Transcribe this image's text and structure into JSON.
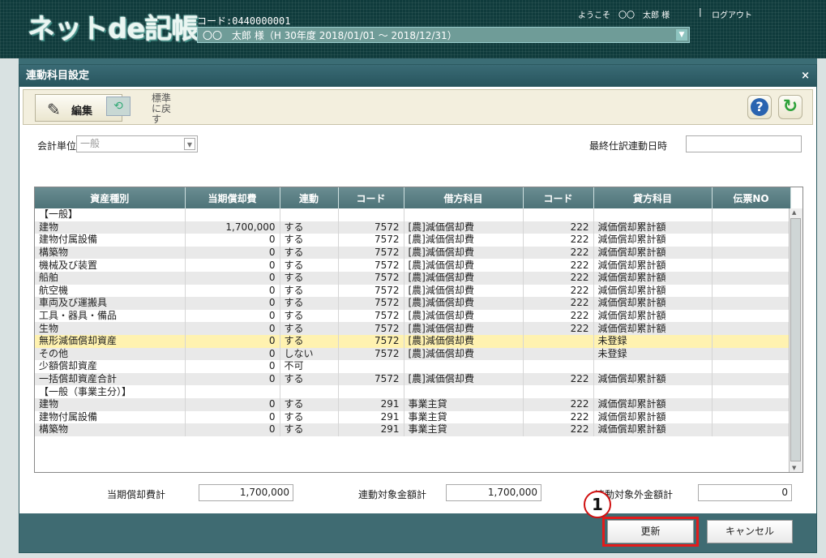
{
  "app": {
    "logo": "ネットde記帳",
    "code": "コード:0440000001",
    "user_info": "〇〇　太郎 様（H 30年度 2018/01/01 ～ 2018/12/31）",
    "welcome": "ようこそ　〇〇　太郎 様",
    "separator": "|",
    "logout": "ログアウト"
  },
  "dialog": {
    "title": "連動科目設定",
    "close": "×",
    "toolbar": {
      "edit_label": "編集",
      "reset_label": "標準に戻す"
    },
    "unit_label": "会計単位",
    "unit_value": "一般",
    "last_date_label": "最終仕訳連動日時",
    "last_date_value": ""
  },
  "grid": {
    "columns": [
      "資産種別",
      "当期償却費",
      "連動",
      "コード",
      "借方科目",
      "コード",
      "貸方科目",
      "伝票NO"
    ],
    "rows": [
      [
        "【一般】",
        "",
        "",
        "",
        "",
        "",
        "",
        ""
      ],
      [
        "建物",
        "1,700,000",
        "する",
        "7572",
        "[農]減価償却費",
        "222",
        "減価償却累計額",
        ""
      ],
      [
        "建物付属設備",
        "0",
        "する",
        "7572",
        "[農]減価償却費",
        "222",
        "減価償却累計額",
        ""
      ],
      [
        "構築物",
        "0",
        "する",
        "7572",
        "[農]減価償却費",
        "222",
        "減価償却累計額",
        ""
      ],
      [
        "機械及び装置",
        "0",
        "する",
        "7572",
        "[農]減価償却費",
        "222",
        "減価償却累計額",
        ""
      ],
      [
        "船舶",
        "0",
        "する",
        "7572",
        "[農]減価償却費",
        "222",
        "減価償却累計額",
        ""
      ],
      [
        "航空機",
        "0",
        "する",
        "7572",
        "[農]減価償却費",
        "222",
        "減価償却累計額",
        ""
      ],
      [
        "車両及び運搬具",
        "0",
        "する",
        "7572",
        "[農]減価償却費",
        "222",
        "減価償却累計額",
        ""
      ],
      [
        "工具・器具・備品",
        "0",
        "する",
        "7572",
        "[農]減価償却費",
        "222",
        "減価償却累計額",
        ""
      ],
      [
        "生物",
        "0",
        "する",
        "7572",
        "[農]減価償却費",
        "222",
        "減価償却累計額",
        ""
      ],
      [
        "無形減価償却資産",
        "0",
        "する",
        "7572",
        "[農]減価償却費",
        "",
        "未登録",
        ""
      ],
      [
        "その他",
        "0",
        "しない",
        "7572",
        "[農]減価償却費",
        "",
        "未登録",
        ""
      ],
      [
        "少額償却資産",
        "0",
        "不可",
        "",
        "",
        "",
        "",
        ""
      ],
      [
        "一括償却資産合計",
        "0",
        "する",
        "7572",
        "[農]減価償却費",
        "222",
        "減価償却累計額",
        ""
      ],
      [
        "【一般（事業主分）】",
        "",
        "",
        "",
        "",
        "",
        "",
        ""
      ],
      [
        "建物",
        "0",
        "する",
        "291",
        "事業主貸",
        "222",
        "減価償却累計額",
        ""
      ],
      [
        "建物付属設備",
        "0",
        "する",
        "291",
        "事業主貸",
        "222",
        "減価償却累計額",
        ""
      ],
      [
        "構築物",
        "0",
        "する",
        "291",
        "事業主貸",
        "222",
        "減価償却累計額",
        ""
      ]
    ],
    "highlight_row": 10
  },
  "totals": {
    "depr_label": "当期償却費計",
    "depr_value": "1,700,000",
    "linked_label": "連動対象金額計",
    "linked_value": "1,700,000",
    "unlinked_label": "連動対象外金額計",
    "unlinked_value": "0"
  },
  "footer": {
    "update_label": "更新",
    "cancel_label": "キャンセル",
    "marker": "1"
  },
  "colors": {
    "highlight_row": "#fff2b0",
    "header": "#4d7378",
    "callout": "#e31b1b"
  }
}
